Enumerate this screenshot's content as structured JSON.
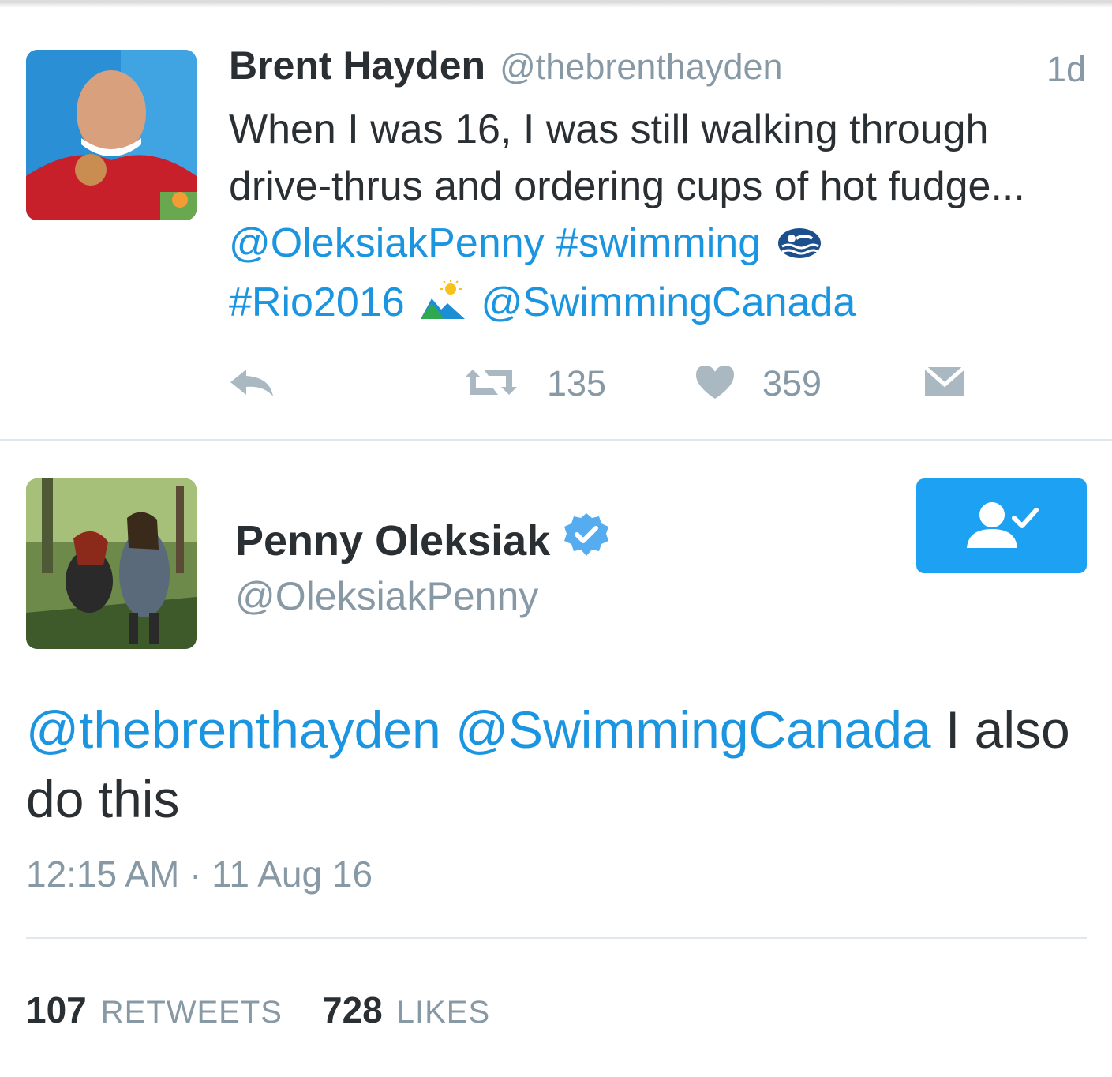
{
  "tweet1": {
    "name": "Brent Hayden",
    "handle": "@thebrenthayden",
    "time": "1d",
    "text_line1": "When I was 16, I was still walking through",
    "text_line2": "drive-thrus and ordering cups of hot fudge...",
    "mention1": "@OleksiakPenny",
    "hashtag1": "#swimming",
    "hashtag2": "#Rio2016",
    "mention2": "@SwimmingCanada",
    "retweet_count": "135",
    "like_count": "359",
    "icons": [
      "reply-icon",
      "retweet-icon",
      "heart-icon",
      "message-icon"
    ]
  },
  "tweet2": {
    "name": "Penny Oleksiak",
    "handle": "@OleksiakPenny",
    "mention1": "@thebrenthayden",
    "mention2": "@SwimmingCanada",
    "text_rest": " I also do this",
    "timestamp": "12:15 AM · 11 Aug 16",
    "retweets_count": "107",
    "retweets_label": "RETWEETS",
    "likes_count": "728",
    "likes_label": "LIKES",
    "follow_icon": "following-check-icon"
  },
  "colors": {
    "link": "#1b95e0",
    "muted": "#8899a6",
    "text": "#292f33",
    "follow_button": "#1da1f2"
  }
}
